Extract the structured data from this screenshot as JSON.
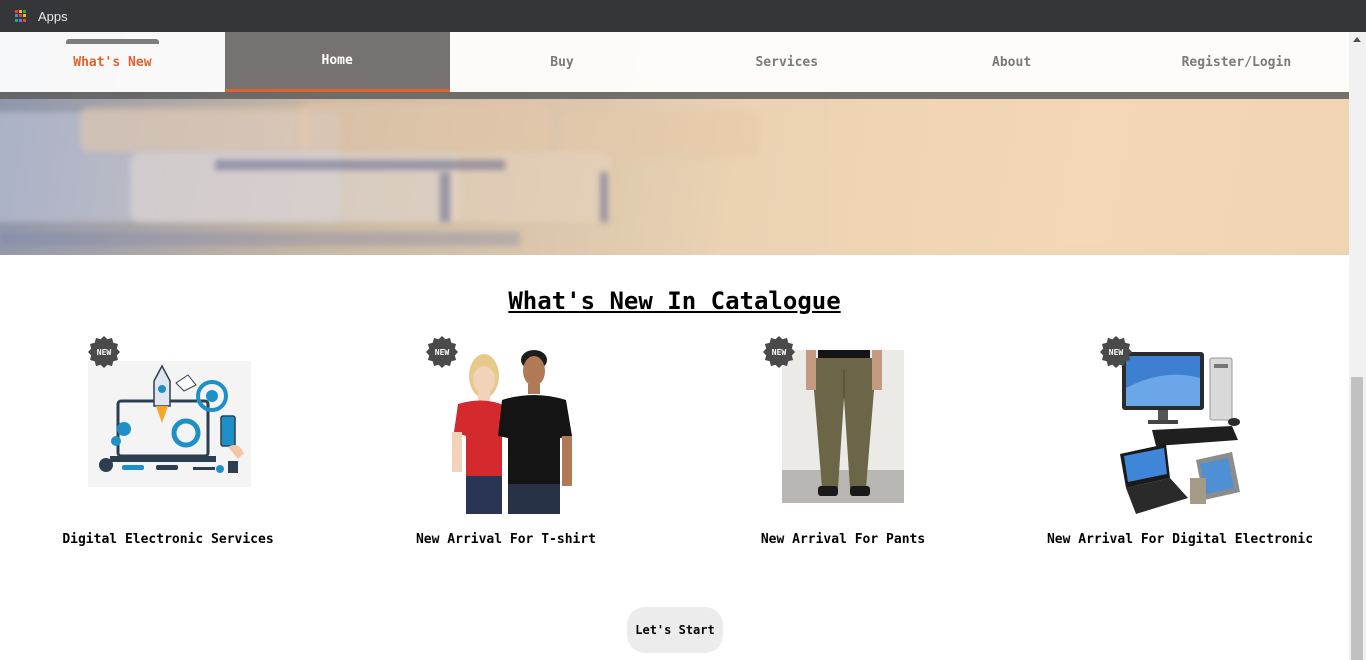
{
  "browser": {
    "bookmarks": {
      "apps_label": "Apps"
    },
    "apps_icon_colors": [
      "#ea4335",
      "#fbbc05",
      "#34a853",
      "#4285f4",
      "#ea4335",
      "#fbbc05",
      "#34a853",
      "#4285f4",
      "#ea4335"
    ]
  },
  "nav": {
    "items": [
      {
        "label": "What's New"
      },
      {
        "label": "Home"
      },
      {
        "label": "Buy"
      },
      {
        "label": "Services"
      },
      {
        "label": "About"
      },
      {
        "label": "Register/Login"
      }
    ],
    "active": "Home",
    "accent_color": "#e0622f"
  },
  "catalogue": {
    "title": "What's New In Catalogue",
    "badge_text": "NEW",
    "products": [
      {
        "label": "Digital Electronic Services",
        "image": "digital-services-illustration"
      },
      {
        "label": "New Arrival For T-shirt",
        "image": "tshirt-models-photo"
      },
      {
        "label": "New Arrival For Pants",
        "image": "pants-photo"
      },
      {
        "label": "New Arrival For Digital Electronic",
        "image": "computers-photo"
      }
    ]
  },
  "cta": {
    "label": "Let's Start"
  }
}
